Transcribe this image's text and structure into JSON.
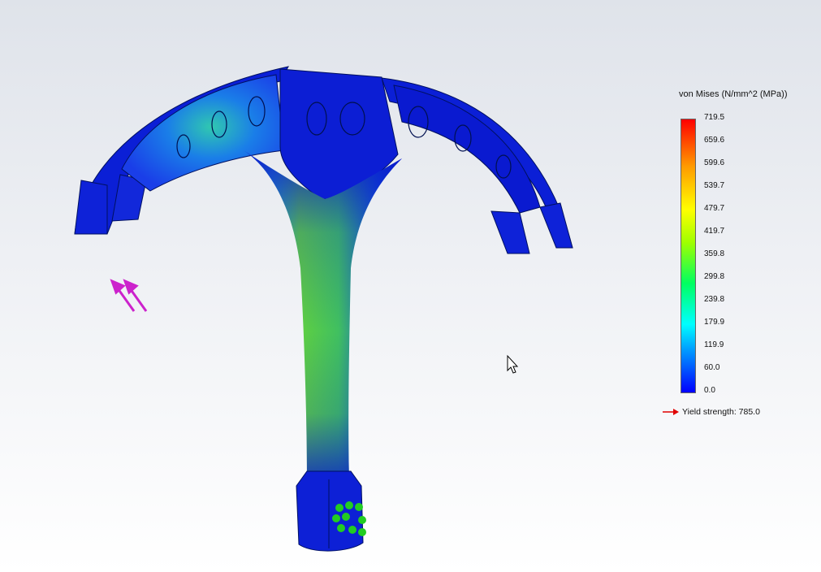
{
  "legend": {
    "title": "von Mises (N/mm^2 (MPa))",
    "ticks": [
      "719.5",
      "659.6",
      "599.6",
      "539.7",
      "479.7",
      "419.7",
      "359.8",
      "299.8",
      "239.8",
      "179.9",
      "119.9",
      "60.0",
      "0.0"
    ],
    "yield_label": "Yield strength: 785.0"
  },
  "colors": {
    "low": "#0000ff",
    "mid": "#00ff40",
    "high": "#ff0000",
    "load_arrows": "#cc22cc",
    "fixture": "#22cc22",
    "yield_arrow": "#e00000"
  },
  "icons": [
    "load-arrows-icon",
    "fixture-icon",
    "cursor-icon",
    "yield-arrow-icon"
  ]
}
